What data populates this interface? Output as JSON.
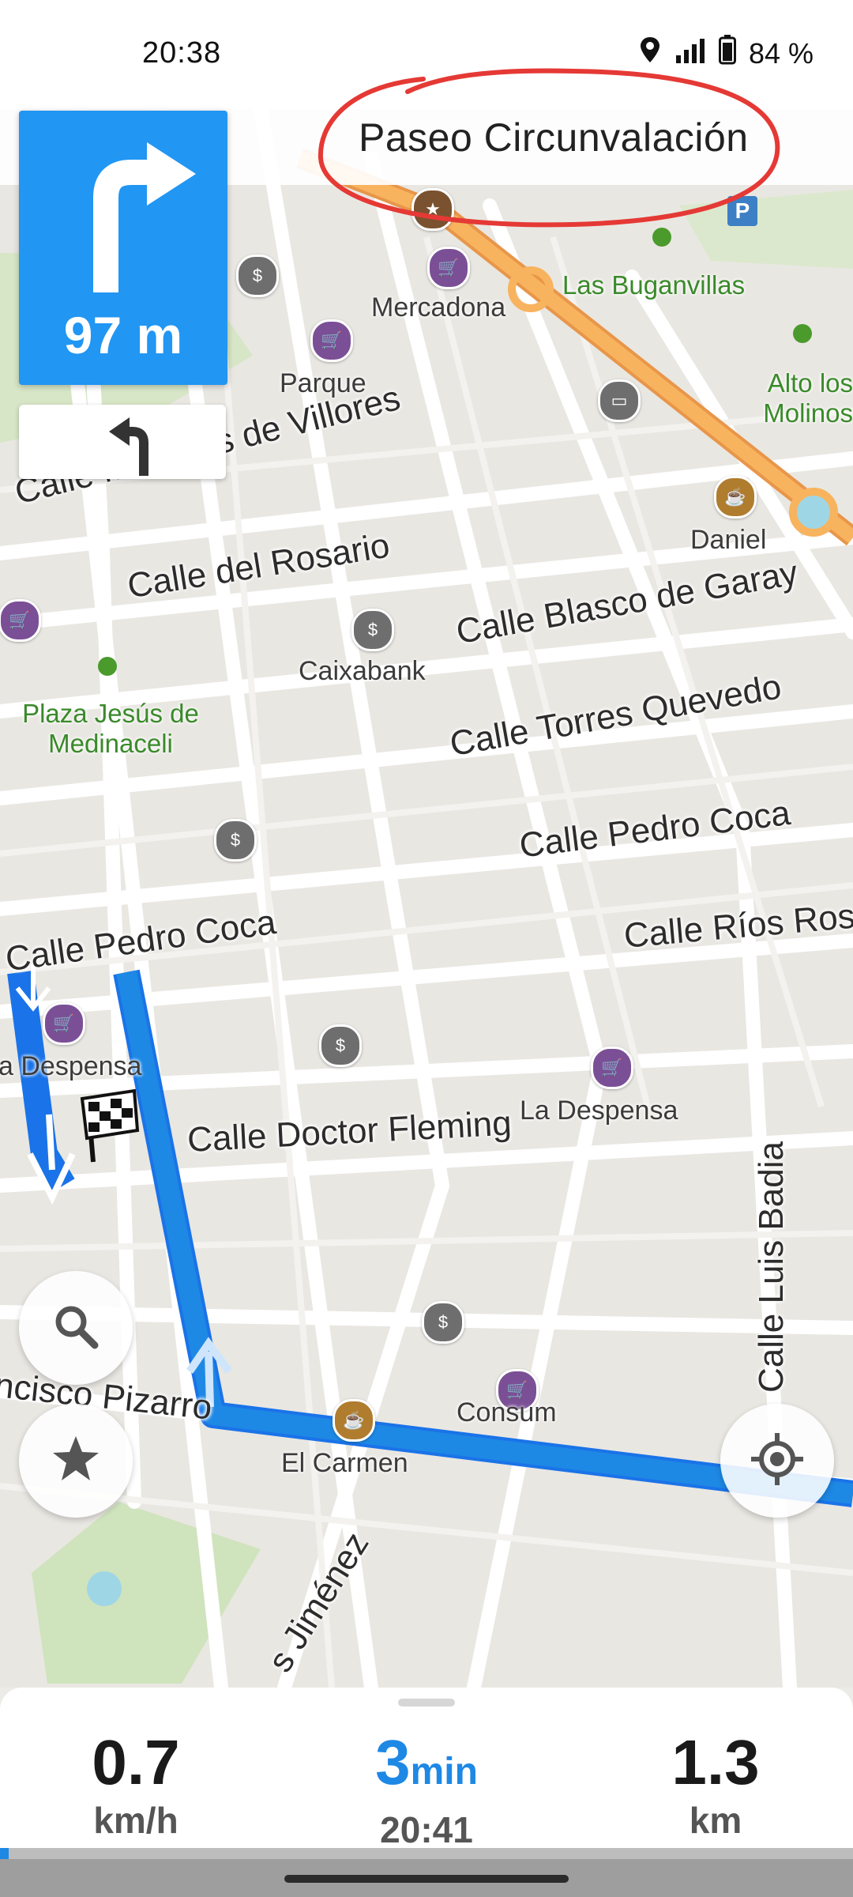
{
  "status": {
    "time": "20:38",
    "battery": "84 %"
  },
  "navigation": {
    "current_street": "Paseo Circunvalación",
    "next_turn_distance": "97 m"
  },
  "map_labels": {
    "roads": [
      "Calle Marques de Villores",
      "Calle del Rosario",
      "Calle Blasco de Garay",
      "Calle Torres Quevedo",
      "Calle Pedro Coca",
      "Calle Pedro Coca",
      "Calle Ríos Ros",
      "Calle Doctor Fleming",
      "Calle Luis Badia",
      "ncisco Pizarro",
      "s Jiménez"
    ],
    "pois": [
      "Mercadona",
      "Parque",
      "Daniel",
      "Caixabank",
      "a Despensa",
      "La Despensa",
      "Consum",
      "El Carmen"
    ],
    "parks": [
      "Las Buganvillas",
      "Alto los Molinos",
      "Plaza Jesús de Medinaceli"
    ]
  },
  "trip": {
    "speed_value": "0.7",
    "speed_unit": "km/h",
    "time_value": "3",
    "time_unit": "min",
    "eta": "20:41",
    "distance_value": "1.3",
    "distance_unit": "km",
    "progress_fraction": 0.01
  },
  "colors": {
    "accent": "#2196f3",
    "route": "#1a73e8",
    "highway": "#f6a54b"
  }
}
